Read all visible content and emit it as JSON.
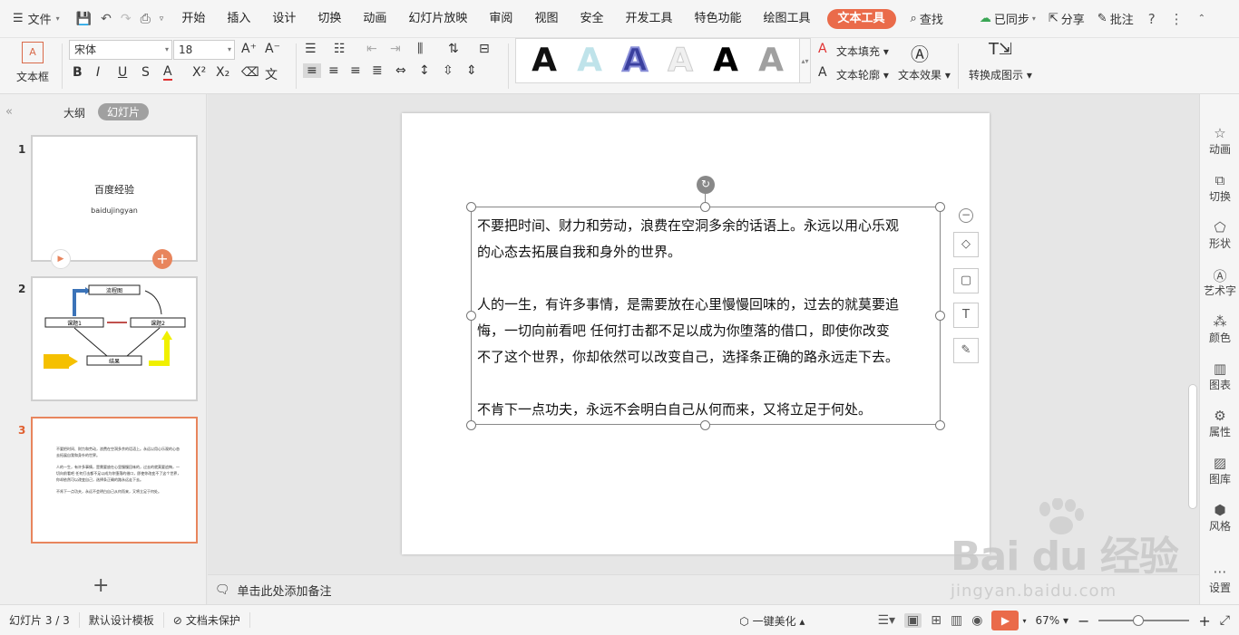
{
  "menubar": {
    "file_label": "文件",
    "tabs": [
      "开始",
      "插入",
      "设计",
      "切换",
      "动画",
      "幻灯片放映",
      "审阅",
      "视图",
      "安全",
      "开发工具",
      "特色功能",
      "绘图工具"
    ],
    "active_tab": "文本工具",
    "search_label": "查找",
    "sync_label": "已同步",
    "share_label": "分享",
    "comment_label": "批注"
  },
  "ribbon": {
    "textbox_label": "文本框",
    "font_name": "宋体",
    "font_size": "18",
    "text_fill_label": "文本填充",
    "text_outline_label": "文本轮廓",
    "text_effect_label": "文本效果",
    "convert_label": "转换成图示",
    "wordart_glyph": "A",
    "wordart_colors": [
      "#111111",
      "#bfe3ea",
      "#3a3f9e",
      "#f0f0f0",
      "#000000",
      "#9a9a9a"
    ]
  },
  "left_panel": {
    "tab_outline": "大纲",
    "tab_slides": "幻灯片",
    "slides": [
      {
        "number": "1",
        "title": "百度经验",
        "subtitle": "baidujingyan"
      },
      {
        "number": "2",
        "boxes": [
          "流程图",
          "课题1",
          "课题2",
          "结果"
        ]
      },
      {
        "number": "3",
        "paragraphs": [
          "不要把时间、财力和劳动，浪费在空洞多余的话语上。永远以用心乐观的心态去拓展自我和身外的世界。",
          "人的一生，有许多事情，是需要放在心里慢慢回味的，过去的就莫要追悔，一切向前看吧 任何打击都不足以成为你堕落的借口，即使你改变不了这个世界，你却依然可以改变自己，选择条正确的路永远走下去。",
          "不肯下一点功夫，永远不会明白自己从何而来，又将立足于何处。"
        ]
      }
    ]
  },
  "slide": {
    "lines": [
      "不要把时间、财力和劳动，浪费在空洞多余的话语上。永远以用心乐观",
      "的心态去拓展自我和身外的世界。",
      "人的一生，有许多事情，是需要放在心里慢慢回味的，过去的就莫要追",
      "悔，一切向前看吧 任何打击都不足以成为你堕落的借口，即使你改变",
      "不了这个世界，你却依然可以改变自己，选择条正确的路永远走下去。",
      "不肯下一点功夫，永远不会明白自己从何而来，又将立足于何处。"
    ]
  },
  "notes": {
    "placeholder": "单击此处添加备注"
  },
  "right_sidebar": [
    "动画",
    "切换",
    "形状",
    "艺术字",
    "颜色",
    "图表",
    "属性",
    "图库",
    "风格",
    "设置"
  ],
  "statusbar": {
    "slide_indicator": "幻灯片 3 / 3",
    "template": "默认设计模板",
    "protection": "文档未保护",
    "beautify": "一键美化",
    "zoom": "67%",
    "zoom_fraction": 0.44
  },
  "watermark": {
    "brand": "Bai  du 经验",
    "url": "jingyan.baidu.com"
  }
}
